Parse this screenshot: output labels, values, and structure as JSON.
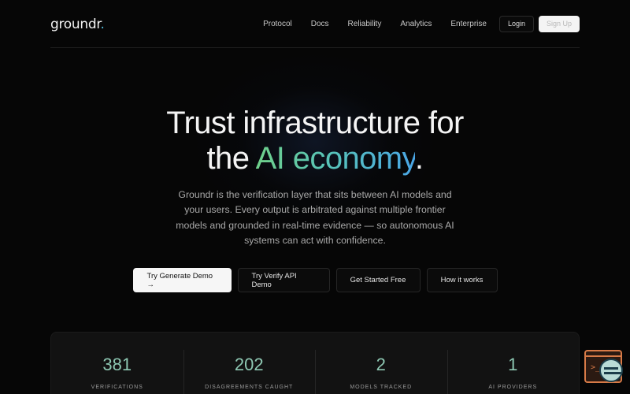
{
  "brand": {
    "name": "groundr",
    "dot": "."
  },
  "nav": {
    "links": [
      "Protocol",
      "Docs",
      "Reliability",
      "Analytics",
      "Enterprise"
    ],
    "login_label": "Login",
    "signup_label": "Sign Up"
  },
  "hero": {
    "title_line1": "Trust infrastructure for",
    "title_line2_pre": "the ",
    "title_line2_highlight": "AI economy",
    "title_line2_post": ".",
    "subtitle": "Groundr is the verification layer that sits between AI models and your users. Every output is arbitrated against multiple frontier models and grounded in real-time evidence — so autonomous AI systems can act with confidence."
  },
  "ctas": {
    "generate_demo": "Try Generate Demo →",
    "verify_api_demo": "Try Verify API Demo",
    "get_started": "Get Started Free",
    "how_it_works": "How it works"
  },
  "stats": [
    {
      "value": "381",
      "label": "VERIFICATIONS"
    },
    {
      "value": "202",
      "label": "DISAGREEMENTS CAUGHT"
    },
    {
      "value": "2",
      "label": "MODELS TRACKED"
    },
    {
      "value": "1",
      "label": "AI PROVIDERS"
    }
  ],
  "colors": {
    "background": "#060606",
    "accent_gradient_start": "#6fd08a",
    "accent_gradient_end": "#4aa6e6",
    "stat_value": "#8ec8b3",
    "widget_accent": "#d77a47"
  },
  "widget": {
    "prompt": ">_",
    "icon": "terminal-icon",
    "avatar_icon": "chat-avatar-icon"
  }
}
